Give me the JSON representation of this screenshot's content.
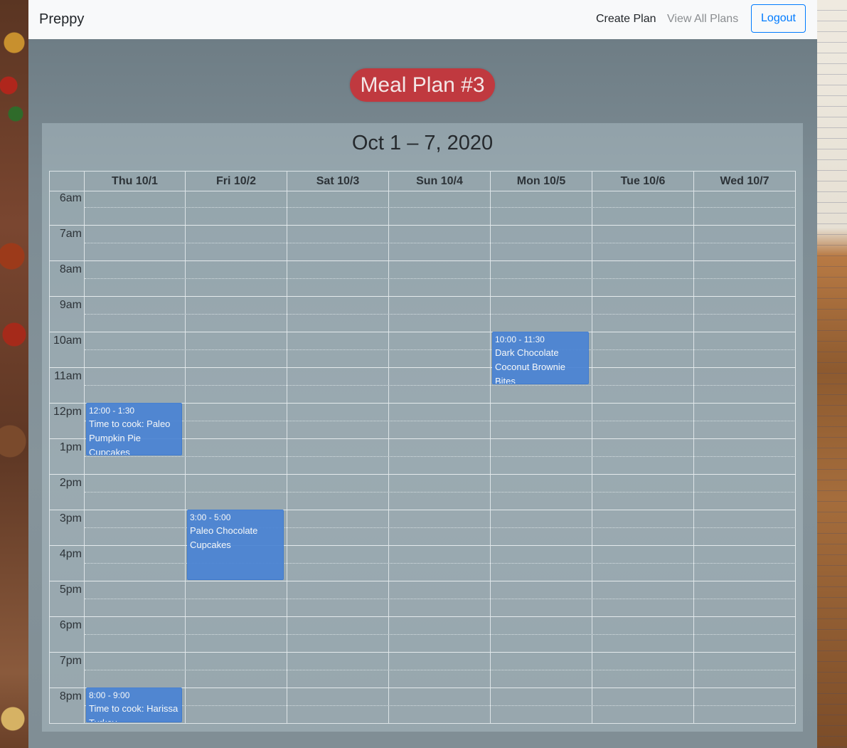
{
  "navbar": {
    "brand": "Preppy",
    "create_plan": "Create Plan",
    "view_all_plans": "View All Plans",
    "logout": "Logout"
  },
  "plan": {
    "title": "Meal Plan #3"
  },
  "calendar": {
    "range_title": "Oct 1 – 7, 2020",
    "days": [
      "Thu 10/1",
      "Fri 10/2",
      "Sat 10/3",
      "Sun 10/4",
      "Mon 10/5",
      "Tue 10/6",
      "Wed 10/7"
    ],
    "times": [
      "6am",
      "7am",
      "8am",
      "9am",
      "10am",
      "11am",
      "12pm",
      "1pm",
      "2pm",
      "3pm",
      "4pm",
      "5pm",
      "6pm",
      "7pm",
      "8pm"
    ],
    "events": [
      {
        "day": "Mon 10/5",
        "time": "10:00 - 11:30",
        "title": "Dark Chocolate Coconut Brownie Bites"
      },
      {
        "day": "Thu 10/1",
        "time": "12:00 - 1:30",
        "title": "Time to cook: Paleo Pumpkin Pie Cupcakes"
      },
      {
        "day": "Fri 10/2",
        "time": "3:00 - 5:00",
        "title": "Paleo Chocolate Cupcakes"
      },
      {
        "day": "Thu 10/1",
        "time": "8:00 - 9:00",
        "title": "Time to cook: Harissa Turkey"
      }
    ]
  },
  "colors": {
    "event": "#4a84d4",
    "title_badge": "#c0393f",
    "logout": "#007bff"
  }
}
